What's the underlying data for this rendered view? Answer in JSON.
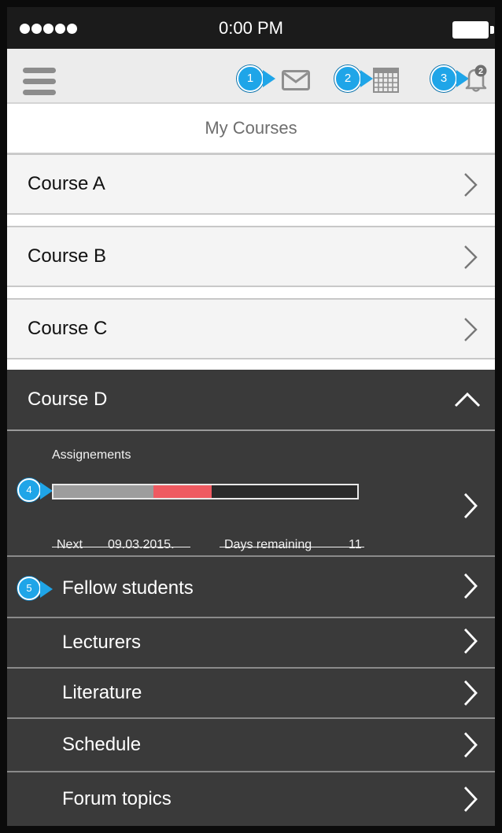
{
  "status_bar": {
    "time": "0:00 PM"
  },
  "header": {
    "menu_icon": "hamburger-menu-icon",
    "callouts": [
      {
        "number": "1",
        "icon": "mail-icon"
      },
      {
        "number": "2",
        "icon": "calendar-icon"
      },
      {
        "number": "3",
        "icon": "bell-icon",
        "notification_count": "2"
      }
    ],
    "accent_color": "#1fa5e8"
  },
  "page_title": "My Courses",
  "courses": [
    {
      "label": "Course A",
      "expanded": false
    },
    {
      "label": "Course B",
      "expanded": false
    },
    {
      "label": "Course C",
      "expanded": false
    },
    {
      "label": "Course D",
      "expanded": true
    }
  ],
  "assignments": {
    "title": "Assignements",
    "callout_number": "4",
    "progress": {
      "completed_fraction": 0.33,
      "due_fraction": 0.19,
      "colors": {
        "completed": "#9d9d9d",
        "due": "#ef5a61"
      }
    },
    "next_label": "Next",
    "next_date": "09.03.2015.",
    "days_remaining_label": "Days remaining",
    "days_remaining_value": "11"
  },
  "course_menu": {
    "callout_number": "5",
    "items": [
      {
        "label": "Fellow students"
      },
      {
        "label": "Lecturers"
      },
      {
        "label": "Literature"
      },
      {
        "label": "Schedule"
      },
      {
        "label": "Forum topics"
      }
    ]
  }
}
